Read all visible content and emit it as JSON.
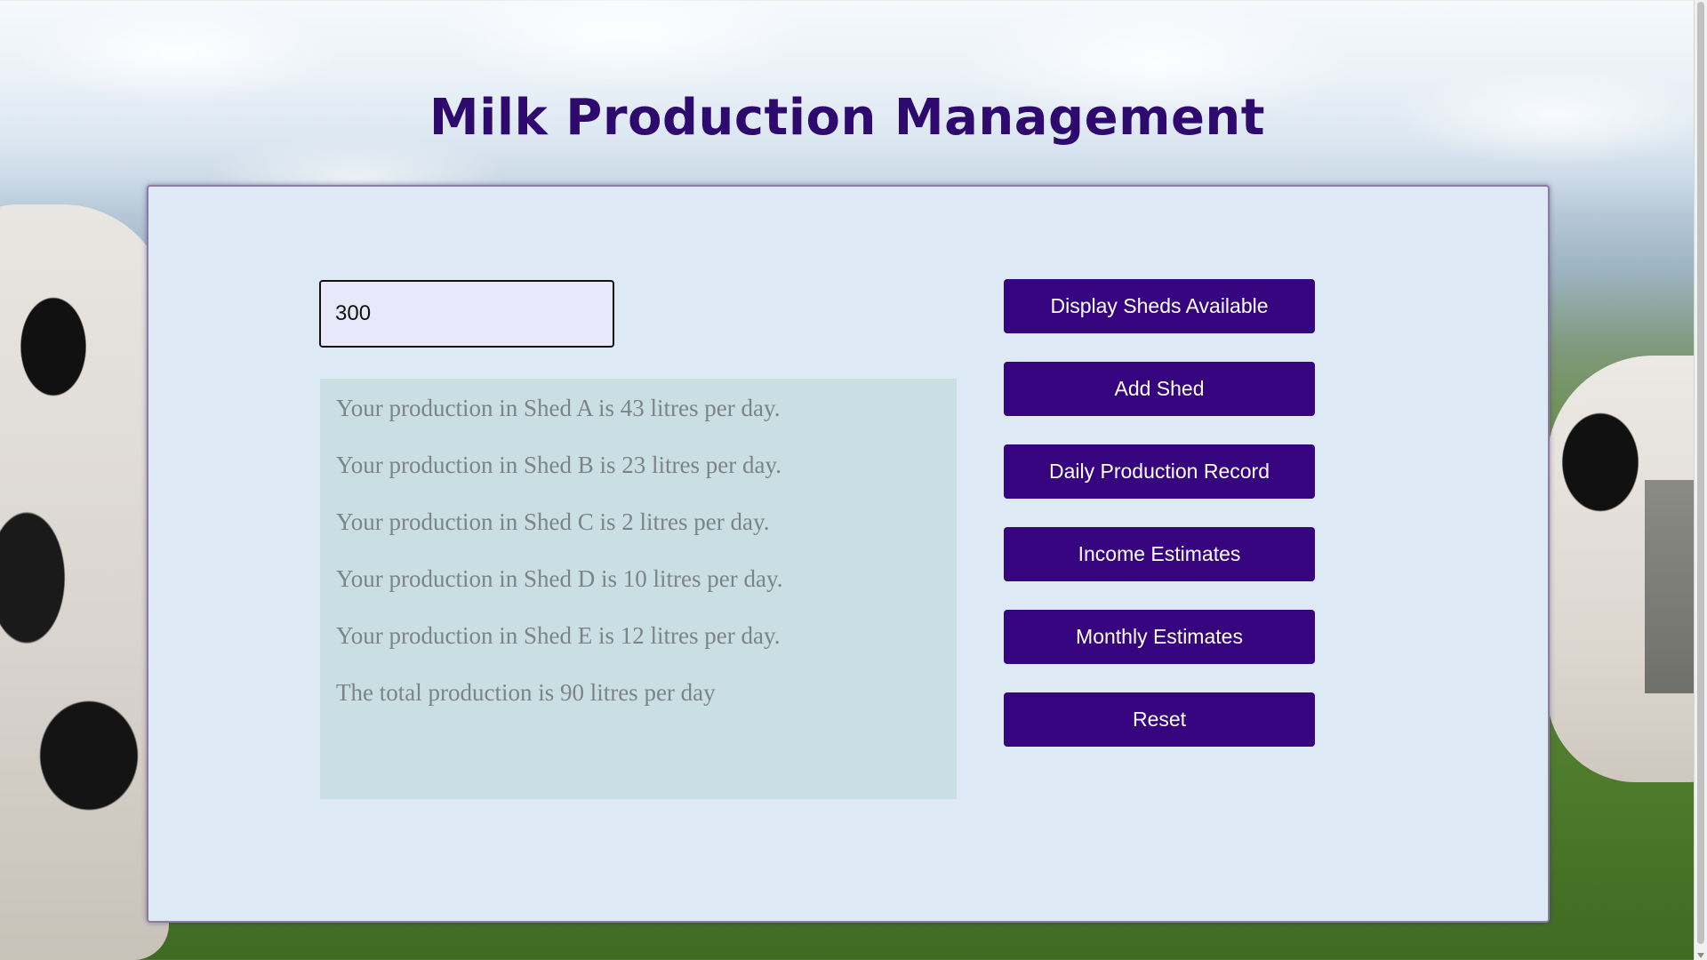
{
  "page": {
    "title": "Milk Production Management"
  },
  "input": {
    "value": "300"
  },
  "results": [
    "Your production in Shed A is 43 litres per day.",
    "Your production in Shed B is 23 litres per day.",
    "Your production in Shed C is 2 litres per day.",
    "Your production in Shed D is 10 litres per day.",
    "Your production in Shed E is 12 litres per day.",
    "The total production is 90 litres per day"
  ],
  "buttons": {
    "display_sheds": "Display Sheds Available",
    "add_shed": "Add Shed",
    "daily_record": "Daily Production Record",
    "income_estimates": "Income Estimates",
    "monthly_estimates": "Monthly Estimates",
    "reset": "Reset"
  },
  "colors": {
    "title": "#2f0a6e",
    "button_bg": "#35047e",
    "panel_bg": "#dde9f5",
    "results_bg": "#c9dfe3",
    "input_bg": "#e9e8fb"
  }
}
